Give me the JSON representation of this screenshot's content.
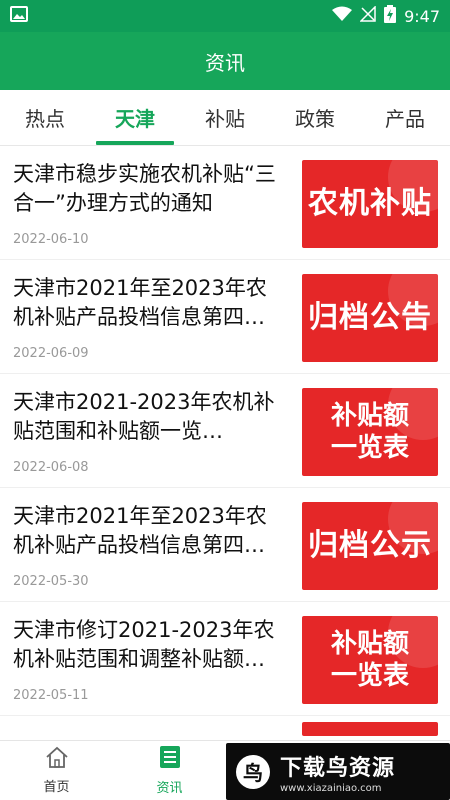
{
  "statusbar": {
    "time": "9:47"
  },
  "appbar": {
    "title": "资讯"
  },
  "tabs": [
    {
      "label": "热点"
    },
    {
      "label": "天津"
    },
    {
      "label": "补贴"
    },
    {
      "label": "政策"
    },
    {
      "label": "产品"
    }
  ],
  "articles": [
    {
      "title": "天津市稳步实施农机补贴“三合一”办理方式的通知",
      "date": "2022-06-10",
      "thumb_line1": "农机补贴",
      "thumb_line2": ""
    },
    {
      "title": "天津市2021年至2023年农机补贴产品投档信息第四…",
      "date": "2022-06-09",
      "thumb_line1": "归档公告",
      "thumb_line2": ""
    },
    {
      "title": "天津市2021-2023年农机补贴范围和补贴额一览…",
      "date": "2022-06-08",
      "thumb_line1": "补贴额",
      "thumb_line2": "一览表"
    },
    {
      "title": "天津市2021年至2023年农机补贴产品投档信息第四…",
      "date": "2022-05-30",
      "thumb_line1": "归档公示",
      "thumb_line2": ""
    },
    {
      "title": "天津市修订2021-2023年农机补贴范围和调整补贴额…",
      "date": "2022-05-11",
      "thumb_line1": "补贴额",
      "thumb_line2": "一览表"
    }
  ],
  "bottomnav": [
    {
      "label": "首页",
      "icon": "home-icon"
    },
    {
      "label": "资讯",
      "icon": "news-icon"
    }
  ],
  "watermark": {
    "main": "下载鸟资源",
    "sub": "www.xiazainiao.com"
  },
  "colors": {
    "primary": "#16a65a",
    "thumb_red": "#e52728"
  }
}
